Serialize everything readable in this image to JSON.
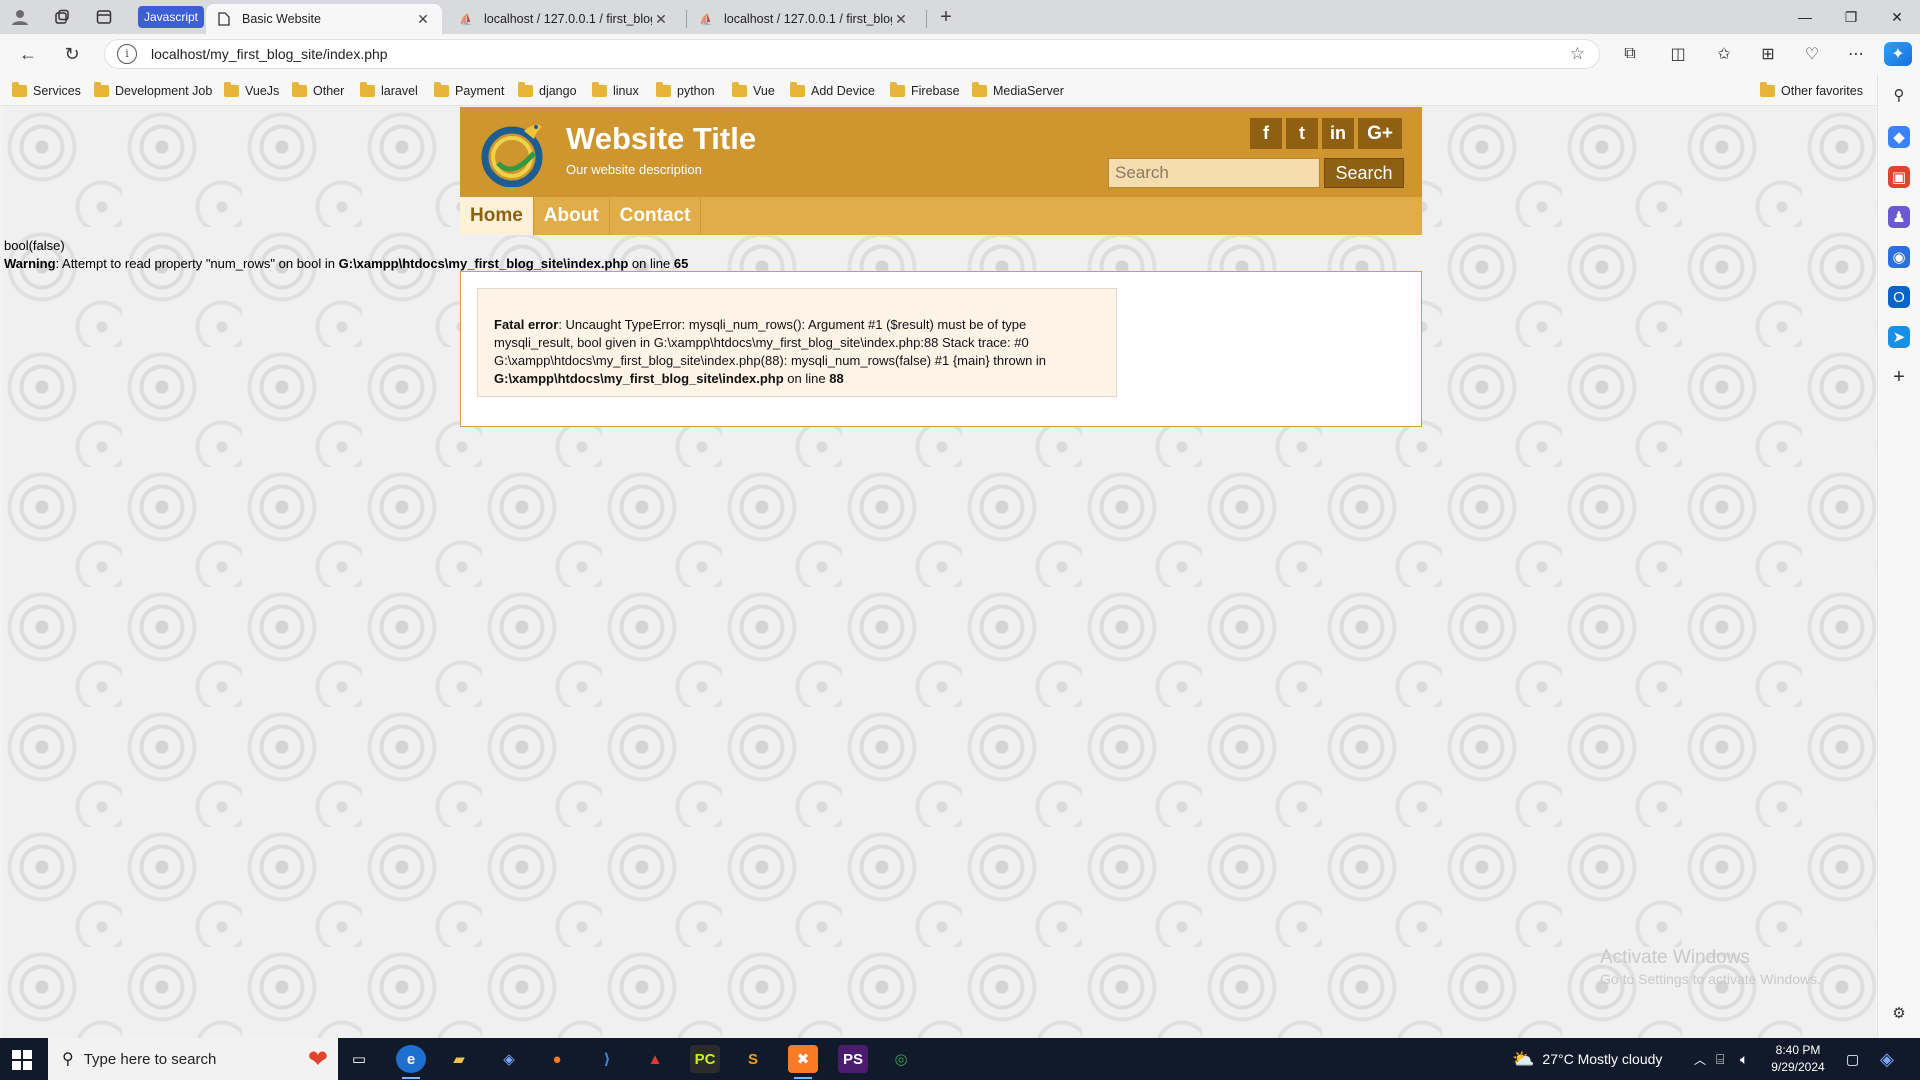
{
  "browser": {
    "tab_group_label": "Javascript",
    "tabs": [
      {
        "title": "Basic Website",
        "active": true
      },
      {
        "title": "localhost / 127.0.0.1 / first_blog_s",
        "active": false
      },
      {
        "title": "localhost / 127.0.0.1 / first_blog_s",
        "active": false
      }
    ],
    "url": "localhost/my_first_blog_site/index.php",
    "bookmarks": [
      "Services",
      "Development Job",
      "VueJs",
      "Other",
      "laravel",
      "Payment",
      "django",
      "linux",
      "python",
      "Vue",
      "Add Device",
      "Firebase",
      "MediaServer"
    ],
    "other_favorites": "Other favorites"
  },
  "php_output": {
    "dump": "bool(false)",
    "warning_label": "Warning",
    "warning_text": ": Attempt to read property \"num_rows\" on bool in ",
    "warning_file": "G:\\xampp\\htdocs\\my_first_blog_site\\index.php",
    "warning_on_line": " on line ",
    "warning_line": "65"
  },
  "site": {
    "title": "Website Title",
    "description": "Our website description",
    "socials": [
      "f",
      "t",
      "in",
      "G+"
    ],
    "search_placeholder": "Search",
    "search_button": "Search",
    "nav": [
      {
        "label": "Home",
        "active": true
      },
      {
        "label": "About",
        "active": false
      },
      {
        "label": "Contact",
        "active": false
      }
    ]
  },
  "fatal_error": {
    "label": "Fatal error",
    "message": ": Uncaught TypeError: mysqli_num_rows(): Argument #1 ($result) must be of type mysqli_result, bool given in G:\\xampp\\htdocs\\my_first_blog_site\\index.php:88 Stack trace: #0 G:\\xampp\\htdocs\\my_first_blog_site\\index.php(88): mysqli_num_rows(false) #1 {main} thrown in ",
    "file": "G:\\xampp\\htdocs\\my_first_blog_site\\index.php",
    "on_line": " on line ",
    "line": "88"
  },
  "watermark": {
    "line1": "Activate Windows",
    "line2": "Go to Settings to activate Windows."
  },
  "taskbar": {
    "search_placeholder": "Type here to search",
    "weather": "27°C  Mostly cloudy",
    "time": "8:40 PM",
    "date": "9/29/2024"
  }
}
